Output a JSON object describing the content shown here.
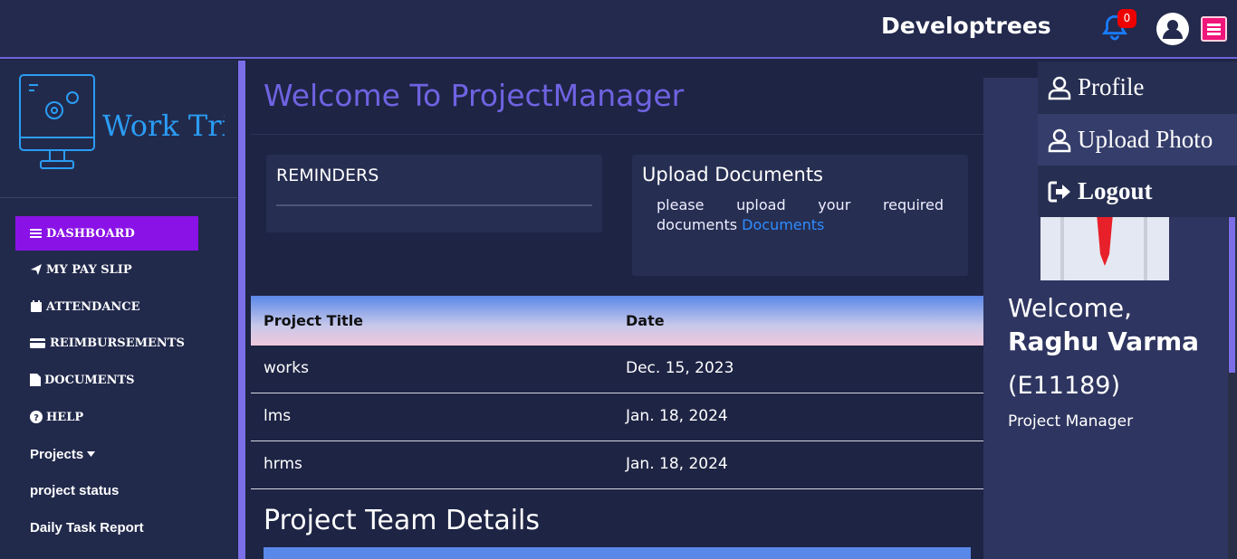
{
  "header": {
    "brand": "Developtrees",
    "notification_count": "0"
  },
  "sidebar": {
    "logo_text": "Work Tried",
    "items": [
      {
        "label": "DASHBOARD",
        "icon": "bars-icon"
      },
      {
        "label": "MY PAY SLIP",
        "icon": "paper-plane-icon"
      },
      {
        "label": "ATTENDANCE",
        "icon": "calendar-icon"
      },
      {
        "label": "REIMBURSEMENTS",
        "icon": "credit-card-icon"
      },
      {
        "label": "DOCUMENTS",
        "icon": "file-icon"
      },
      {
        "label": "HELP",
        "icon": "question-circle-icon"
      },
      {
        "label": "Projects",
        "icon": "caret-down-icon"
      },
      {
        "label": "project status"
      },
      {
        "label": "Daily Task Report"
      }
    ]
  },
  "main": {
    "welcome_title": "Welcome To ProjectManager",
    "reminders_title": "REMINDERS",
    "upload_title": "Upload Documents",
    "upload_text": "please upload your required documents",
    "upload_link": "Documents",
    "table": {
      "headers": [
        "Project Title",
        "Date"
      ],
      "rows": [
        [
          "works",
          "Dec. 15, 2023"
        ],
        [
          "lms",
          "Jan. 18, 2024"
        ],
        [
          "hrms",
          "Jan. 18, 2024"
        ]
      ]
    },
    "team_title": "Project Team Details"
  },
  "profile": {
    "welcome": "Welcome,",
    "name": "Raghu Varma",
    "emp_id": "(E11189)",
    "role": "Project Manager"
  },
  "dropdown": {
    "items": [
      {
        "label": "Profile",
        "icon": "user-icon"
      },
      {
        "label": "Upload Photo",
        "icon": "user-icon"
      },
      {
        "label": "Logout",
        "icon": "sign-out-icon"
      }
    ]
  },
  "colors": {
    "accent": "#6f63e2",
    "active_nav": "#8a12e6",
    "menu_button": "#f0157a",
    "link": "#2f8cff"
  }
}
